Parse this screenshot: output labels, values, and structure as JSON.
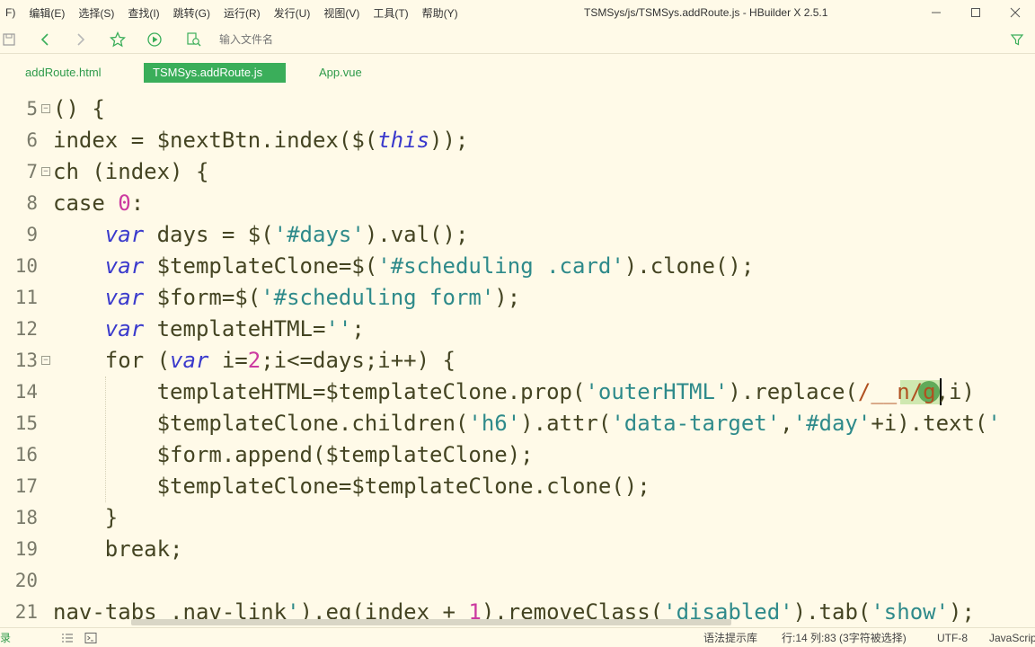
{
  "menubar": {
    "items": [
      "F)",
      "编辑(E)",
      "选择(S)",
      "查找(I)",
      "跳转(G)",
      "运行(R)",
      "发行(U)",
      "视图(V)",
      "工具(T)",
      "帮助(Y)"
    ],
    "title": "TSMSys/js/TSMSys.addRoute.js - HBuilder X 2.5.1"
  },
  "toolbar": {
    "file_search_placeholder": "输入文件名"
  },
  "tabs": [
    {
      "label": "addRoute.html",
      "active": false
    },
    {
      "label": "TSMSys.addRoute.js",
      "active": true
    },
    {
      "label": "App.vue",
      "active": false
    }
  ],
  "editor": {
    "line_numbers": [
      "5",
      "6",
      "7",
      "8",
      "9",
      "10",
      "11",
      "12",
      "13",
      "14",
      "15",
      "16",
      "17",
      "18",
      "19",
      "20",
      "21"
    ],
    "foldable_lines": [
      "5",
      "7",
      "13"
    ]
  },
  "statusbar": {
    "left": "录",
    "syntax_hint": "语法提示库",
    "position": "行:14  列:83 (3字符被选择)",
    "encoding": "UTF-8",
    "language": "JavaScript"
  },
  "colors": {
    "background": "#fffae8",
    "accent": "#3aae5a",
    "keyword": "#3a3acc",
    "string": "#2e8a8a",
    "number": "#cc3aa0"
  }
}
